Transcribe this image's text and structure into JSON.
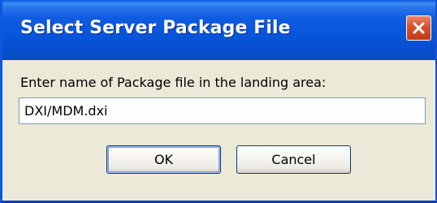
{
  "dialog": {
    "title": "Select Server Package File",
    "prompt": "Enter name of Package file in the landing area:",
    "input_value": "DXI/MDM.dxi",
    "ok_label": "OK",
    "cancel_label": "Cancel"
  },
  "icons": {
    "close": "close-icon"
  },
  "colors": {
    "titlebar": "#0755d8",
    "close_button": "#d8532f",
    "window_body": "#ece9d8",
    "input_border": "#7f9db9",
    "button_border": "#003c74"
  }
}
